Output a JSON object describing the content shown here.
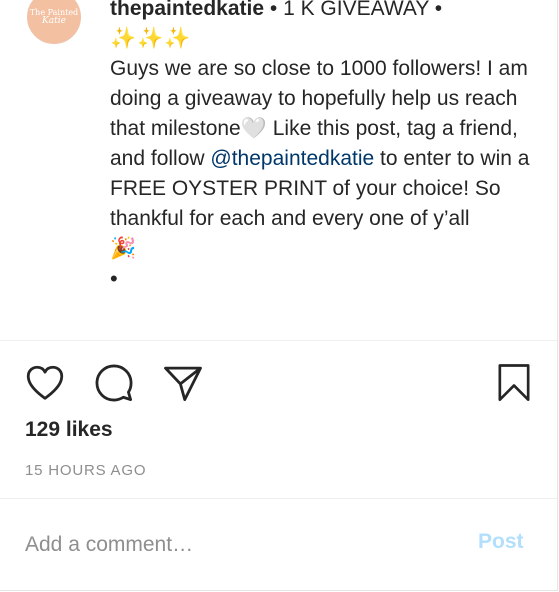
{
  "account": {
    "avatar_text_line1": "The Painted",
    "avatar_text_line2": "Katie"
  },
  "caption": {
    "username": "thepaintedkatie",
    "title": " • 1 K GIVEAWAY •",
    "sparkles": "✨✨✨",
    "text_part1": "Guys we are so close to 1000 followers! I am doing a giveaway to hopefully help us reach that milestone🤍 Like this post, tag a friend, and follow ",
    "mention": "@thepaintedkatie",
    "text_part2": " to enter to win a FREE OYSTER PRINT of your choice! So thankful for each and every one of y’all",
    "emoji": "🎉",
    "dot": "•"
  },
  "actions": {
    "like_icon": "heart-icon",
    "comment_icon": "speech-bubble-icon",
    "share_icon": "paper-plane-icon",
    "save_icon": "bookmark-icon"
  },
  "stats": {
    "likes": "129 likes",
    "timestamp": "15 HOURS AGO"
  },
  "comment_box": {
    "placeholder": "Add a comment…",
    "post_label": "Post",
    "post_color": "#b2dffc"
  }
}
